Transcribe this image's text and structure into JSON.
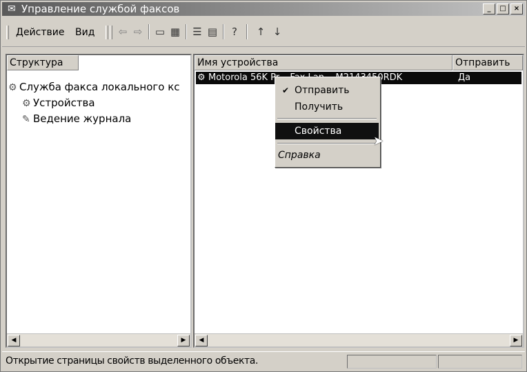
{
  "window": {
    "title": "Управление службой факсов",
    "buttons": [
      "_",
      "□",
      "×"
    ]
  },
  "menubar": {
    "items": [
      "Действие",
      "Вид"
    ],
    "toolbar_icons": [
      "back-arrow-icon",
      "forward-arrow-icon",
      "up-folder-icon",
      "show-tree-icon",
      "properties-icon",
      "export-list-icon",
      "help-icon",
      "move-up-icon",
      "move-down-icon"
    ]
  },
  "left_pane": {
    "tab": "Структура",
    "tree": [
      {
        "label": "Служба факса локального кс",
        "icon": "fax-service-icon"
      },
      {
        "label": "Устройства",
        "icon": "devices-icon"
      },
      {
        "label": "Ведение журнала",
        "icon": "logging-icon"
      }
    ]
  },
  "right_pane": {
    "columns": [
      "Имя устройства",
      "Отправить"
    ],
    "rows": [
      {
        "device": "Motorola 56K Pr... Fax Lan... M2143450RDK",
        "send": "Да"
      }
    ]
  },
  "context_menu": {
    "items": [
      {
        "label": "Отправить",
        "checked": true
      },
      {
        "label": "Получить",
        "checked": false
      },
      {
        "label": "Свойства",
        "selected": true
      },
      {
        "label": "Справка"
      }
    ]
  },
  "statusbar": {
    "text": "Открытие страницы свойств выделенного объекта."
  }
}
